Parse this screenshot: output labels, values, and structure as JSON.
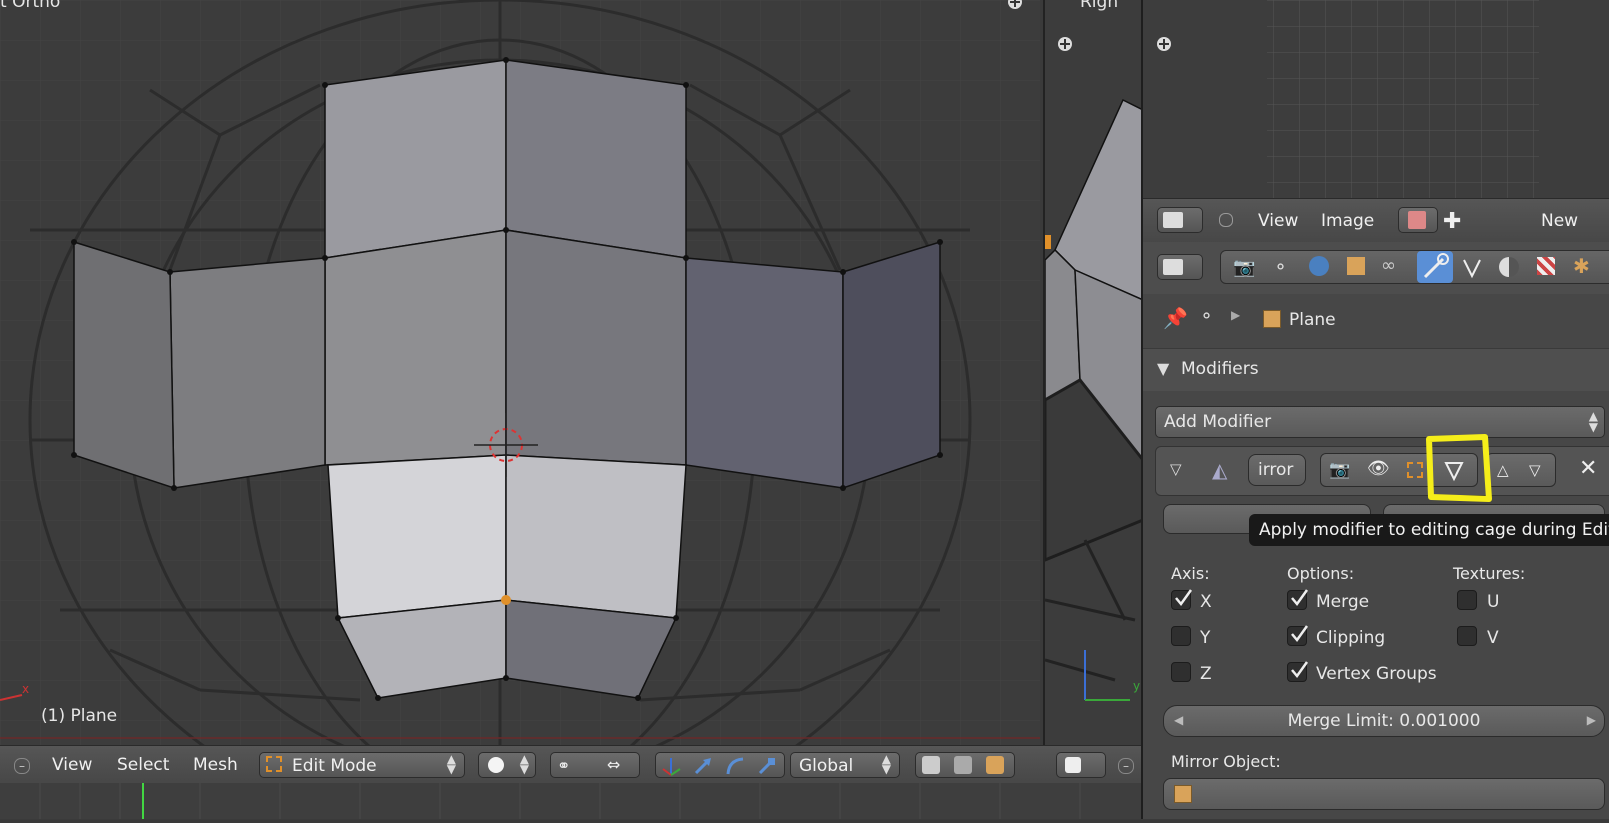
{
  "viewport_main": {
    "view_label": "t Ortho",
    "object_label": "(1) Plane"
  },
  "viewport_right": {
    "view_label": "Righ"
  },
  "header_3d": {
    "menus": [
      "View",
      "Select",
      "Mesh"
    ],
    "mode": "Edit Mode",
    "orientation": "Global"
  },
  "uv_header": {
    "menus": [
      "View",
      "Image"
    ],
    "new_label": "New"
  },
  "properties": {
    "breadcrumb_object": "Plane",
    "modifiers_title": "Modifiers",
    "add_modifier": "Add Modifier",
    "modifier_name": "irror",
    "tooltip": "Apply modifier to editing cage during Editm",
    "axis_label": "Axis:",
    "options_label": "Options:",
    "textures_label": "Textures:",
    "axis": [
      {
        "label": "X",
        "checked": true
      },
      {
        "label": "Y",
        "checked": false
      },
      {
        "label": "Z",
        "checked": false
      }
    ],
    "options": [
      {
        "label": "Merge",
        "checked": true
      },
      {
        "label": "Clipping",
        "checked": true
      },
      {
        "label": "Vertex Groups",
        "checked": true
      }
    ],
    "textures": [
      {
        "label": "U",
        "checked": false
      },
      {
        "label": "V",
        "checked": false
      }
    ],
    "merge_limit": "Merge Limit: 0.001000",
    "mirror_object_label": "Mirror Object:"
  },
  "colors": {
    "highlight": "#f5ee1a",
    "accent_blue": "#5a8fd6",
    "vertex_orange": "#e0902a"
  }
}
